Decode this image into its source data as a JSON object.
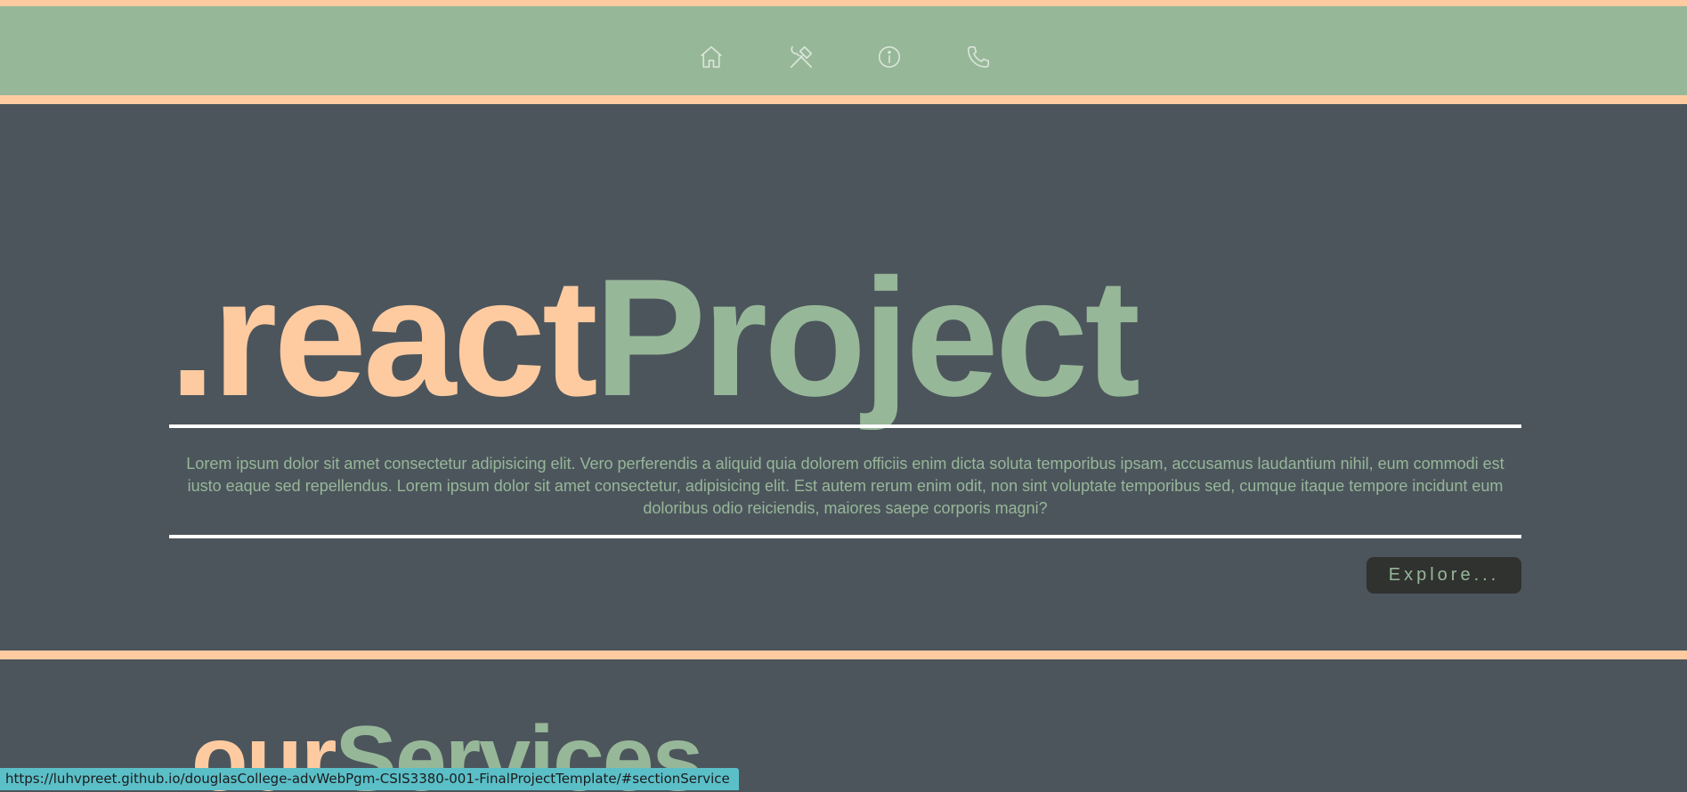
{
  "nav": {
    "items": [
      {
        "icon": "home-icon"
      },
      {
        "icon": "tools-icon"
      },
      {
        "icon": "info-icon"
      },
      {
        "icon": "phone-icon"
      }
    ]
  },
  "hero": {
    "title_part1": ".react",
    "title_part2": "Project",
    "paragraph": "Lorem ipsum dolor sit amet consectetur adipisicing elit. Vero perferendis a aliquid quia dolorem officiis enim dicta soluta temporibus ipsam, accusamus laudantium nihil, eum commodi est iusto eaque sed repellendus. Lorem ipsum dolor sit amet consectetur, adipisicing elit. Est autem rerum enim odit, non sint voluptate temporibus sed, cumque itaque tempore incidunt eum doloribus odio reiciendis, maiores saepe corporis magni?",
    "button_label": "Explore..."
  },
  "services": {
    "title_part1": "our",
    "title_part2": "Services"
  },
  "status_url": "https://luhvpreet.github.io/douglasCollege-advWebPgm-CSIS3380-001-FinalProjectTemplate/#sectionService",
  "colors": {
    "peach": "#fecba1",
    "sage": "#97b799",
    "slate": "#4c555c",
    "button_bg": "#30322f"
  }
}
